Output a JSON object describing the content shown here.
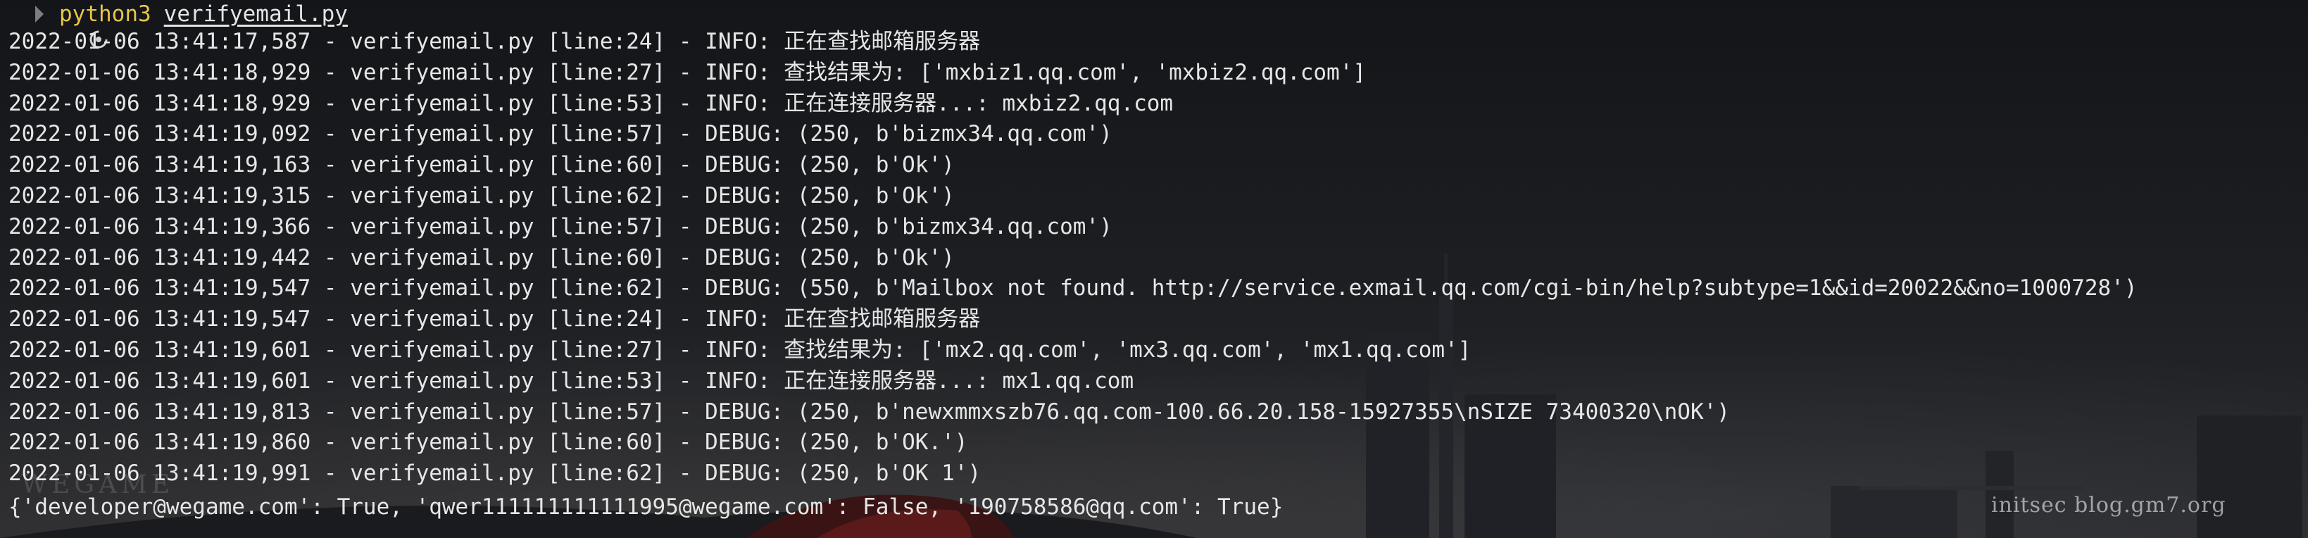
{
  "prompt": {
    "icon": "terminal-prompt-icon",
    "command": "python3",
    "argument": "verifyemail.py"
  },
  "log_lines": [
    "2022-01-06 13:41:17,587 - verifyemail.py [line:24] - INFO: 正在查找邮箱服务器",
    "2022-01-06 13:41:18,929 - verifyemail.py [line:27] - INFO: 查找结果为: ['mxbiz1.qq.com', 'mxbiz2.qq.com']",
    "2022-01-06 13:41:18,929 - verifyemail.py [line:53] - INFO: 正在连接服务器...: mxbiz2.qq.com",
    "2022-01-06 13:41:19,092 - verifyemail.py [line:57] - DEBUG: (250, b'bizmx34.qq.com')",
    "2022-01-06 13:41:19,163 - verifyemail.py [line:60] - DEBUG: (250, b'Ok')",
    "2022-01-06 13:41:19,315 - verifyemail.py [line:62] - DEBUG: (250, b'Ok')",
    "2022-01-06 13:41:19,366 - verifyemail.py [line:57] - DEBUG: (250, b'bizmx34.qq.com')",
    "2022-01-06 13:41:19,442 - verifyemail.py [line:60] - DEBUG: (250, b'Ok')",
    "2022-01-06 13:41:19,547 - verifyemail.py [line:62] - DEBUG: (550, b'Mailbox not found. http://service.exmail.qq.com/cgi-bin/help?subtype=1&&id=20022&&no=1000728')",
    "2022-01-06 13:41:19,547 - verifyemail.py [line:24] - INFO: 正在查找邮箱服务器",
    "2022-01-06 13:41:19,601 - verifyemail.py [line:27] - INFO: 查找结果为: ['mx2.qq.com', 'mx3.qq.com', 'mx1.qq.com']",
    "2022-01-06 13:41:19,601 - verifyemail.py [line:53] - INFO: 正在连接服务器...: mx1.qq.com",
    "2022-01-06 13:41:19,813 - verifyemail.py [line:57] - DEBUG: (250, b'newxmmxszb76.qq.com-100.66.20.158-15927355\\nSIZE 73400320\\nOK')",
    "2022-01-06 13:41:19,860 - verifyemail.py [line:60] - DEBUG: (250, b'OK.')",
    "2022-01-06 13:41:19,991 - verifyemail.py [line:62] - DEBUG: (250, b'OK 1')"
  ],
  "result_line": "{'developer@wegame.com': True, 'qwer111111111111995@wegame.com': False, '190758586@qq.com': True}",
  "watermarks": {
    "left": "WEGAME",
    "right": "initsec blog.gm7.org"
  },
  "colors": {
    "command": "#e8c547",
    "text": "#e6e6e6",
    "background": "#16181b"
  }
}
